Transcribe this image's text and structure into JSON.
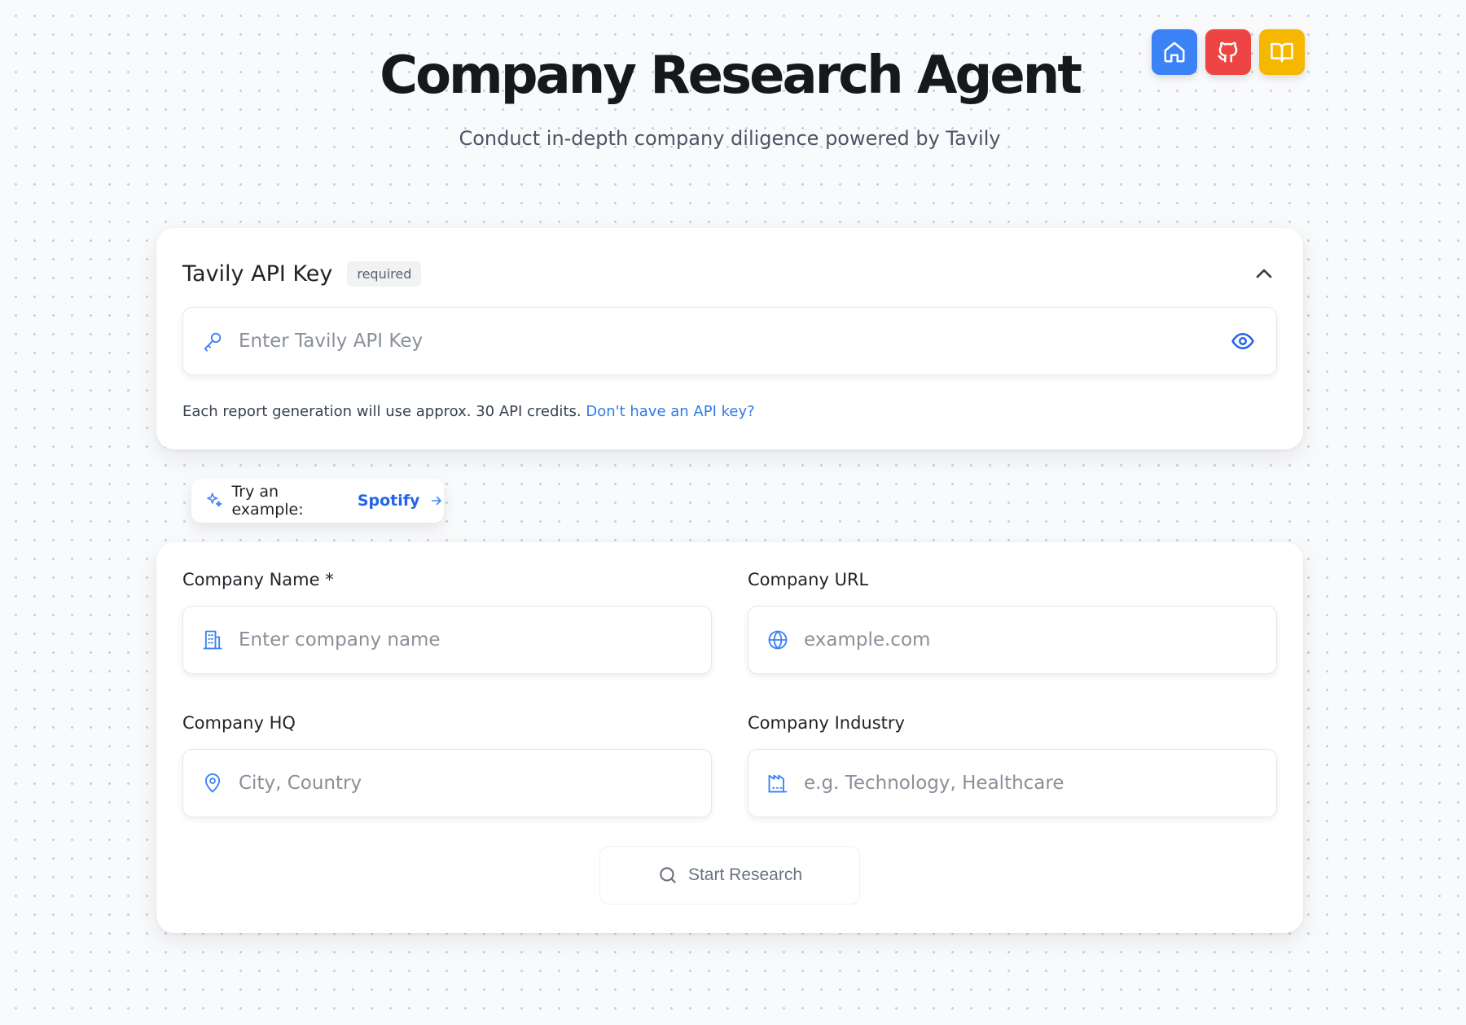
{
  "header": {
    "title": "Company Research Agent",
    "subtitle": "Conduct in-depth company diligence powered by Tavily"
  },
  "top_icons": [
    {
      "name": "home-icon",
      "color": "#3b82f6"
    },
    {
      "name": "github-icon",
      "color": "#ef4444"
    },
    {
      "name": "book-icon",
      "color": "#f5b700"
    }
  ],
  "api_key": {
    "title": "Tavily API Key",
    "badge": "required",
    "placeholder": "Enter Tavily API Key",
    "note": "Each report generation will use approx. 30 API credits.",
    "link": "Don't have an API key?"
  },
  "example": {
    "prefix": "Try an example:",
    "name": "Spotify"
  },
  "form": {
    "company_name": {
      "label": "Company Name *",
      "placeholder": "Enter company name"
    },
    "company_url": {
      "label": "Company URL",
      "placeholder": "example.com"
    },
    "company_hq": {
      "label": "Company HQ",
      "placeholder": "City, Country"
    },
    "company_industry": {
      "label": "Company Industry",
      "placeholder": "e.g. Technology, Healthcare"
    },
    "submit_label": "Start Research"
  },
  "colors": {
    "accent_blue": "#2563eb",
    "icon_blue": "#3b82f6",
    "link": "#2f7be6"
  }
}
